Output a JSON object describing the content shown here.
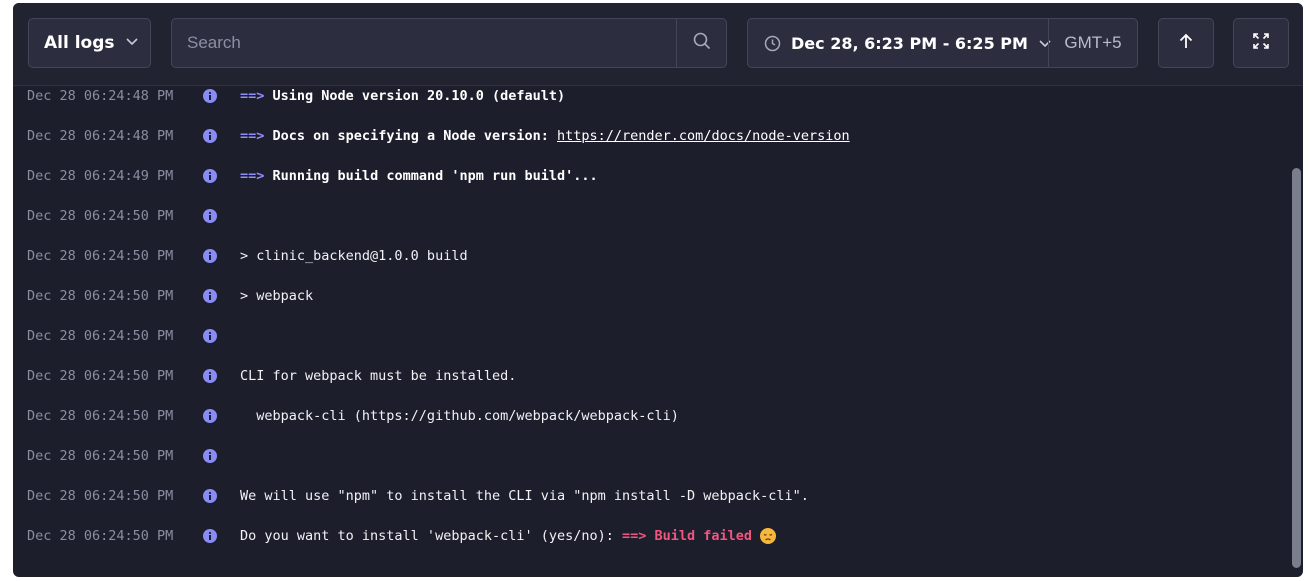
{
  "toolbar": {
    "logs_filter_label": "All logs",
    "search_placeholder": "Search",
    "time_range_label": "Dec 28, 6:23 PM - 6:25 PM",
    "timezone_label": "GMT+5"
  },
  "icons": {
    "logs_filter": "chevron-down-icon",
    "search": "search-icon",
    "time_range": "clock-icon",
    "scroll_top": "arrow-up-icon",
    "fullscreen": "fullscreen-icon",
    "row": "info-icon",
    "emoji": "disappointed-face-icon"
  },
  "colors": {
    "panel_bg": "#1d1e2c",
    "toolbar_bg": "#222331",
    "timestamp": "#8a8da0",
    "arrow_prefix": "#8f8ffb",
    "info_icon": "#8a8cf5",
    "failed": "#f0567e"
  },
  "logs": [
    {
      "ts": "Dec 28 06:24:48 PM",
      "prefix": "==>",
      "text": "Using Node version 20.10.0 (default)",
      "bold": true
    },
    {
      "ts": "Dec 28 06:24:48 PM",
      "prefix": "==>",
      "text": "Docs on specifying a Node version:",
      "bold": true,
      "link": "https://render.com/docs/node-version"
    },
    {
      "ts": "Dec 28 06:24:49 PM",
      "prefix": "==>",
      "text": "Running build command 'npm run build'...",
      "bold": true
    },
    {
      "ts": "Dec 28 06:24:50 PM",
      "text": ""
    },
    {
      "ts": "Dec 28 06:24:50 PM",
      "text": "> clinic_backend@1.0.0 build"
    },
    {
      "ts": "Dec 28 06:24:50 PM",
      "text": "> webpack"
    },
    {
      "ts": "Dec 28 06:24:50 PM",
      "text": ""
    },
    {
      "ts": "Dec 28 06:24:50 PM",
      "text": "CLI for webpack must be installed."
    },
    {
      "ts": "Dec 28 06:24:50 PM",
      "text": "  webpack-cli (https://github.com/webpack/webpack-cli)"
    },
    {
      "ts": "Dec 28 06:24:50 PM",
      "text": ""
    },
    {
      "ts": "Dec 28 06:24:50 PM",
      "text": "We will use \"npm\" to install the CLI via \"npm install -D webpack-cli\"."
    },
    {
      "ts": "Dec 28 06:24:50 PM",
      "text": "Do you want to install 'webpack-cli' (yes/no):",
      "status": "==> Build failed",
      "emoji": true
    }
  ]
}
